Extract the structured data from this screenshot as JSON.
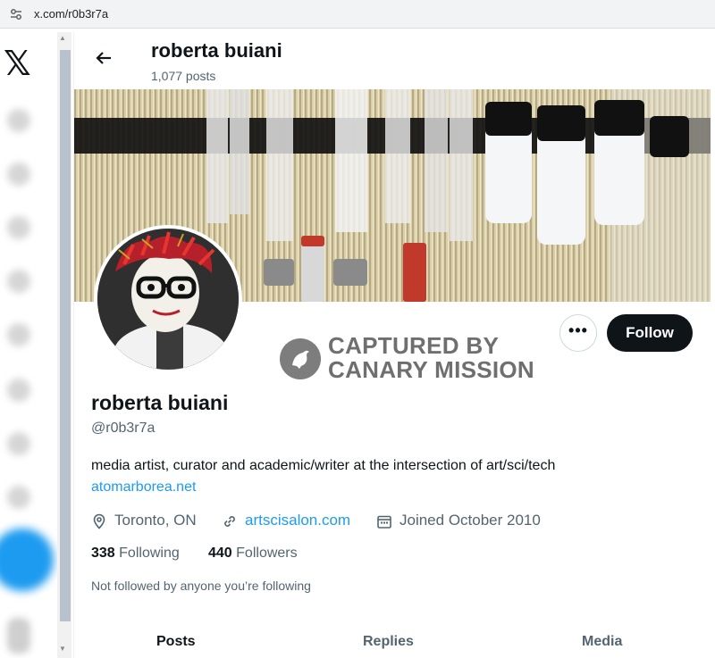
{
  "browser": {
    "url": "x.com/r0b3r7a"
  },
  "nav": {
    "logo": "𝕏"
  },
  "header": {
    "name": "roberta buiani",
    "posts": "1,077 posts"
  },
  "profile": {
    "name": "roberta buiani",
    "handle": "@r0b3r7a",
    "bio": "media artist, curator and academic/writer at the intersection of art/sci/tech",
    "bio_link": "atomarborea.net",
    "location": "Toronto, ON",
    "website": "artscisalon.com",
    "joined": "Joined October 2010",
    "following_count": "338",
    "following_label": "Following",
    "followers_count": "440",
    "followers_label": "Followers",
    "not_followed": "Not followed by anyone you’re following"
  },
  "actions": {
    "more": "•••",
    "follow": "Follow"
  },
  "watermark": {
    "line1": "CAPTURED BY",
    "line2": "CANARY MISSION"
  },
  "tabs": [
    {
      "label": "Posts"
    },
    {
      "label": "Replies"
    },
    {
      "label": "Media"
    }
  ],
  "colors": {
    "accent": "#1d9bf0",
    "text": "#0f1419",
    "muted": "#536471",
    "follow_bg": "#0f1419"
  }
}
